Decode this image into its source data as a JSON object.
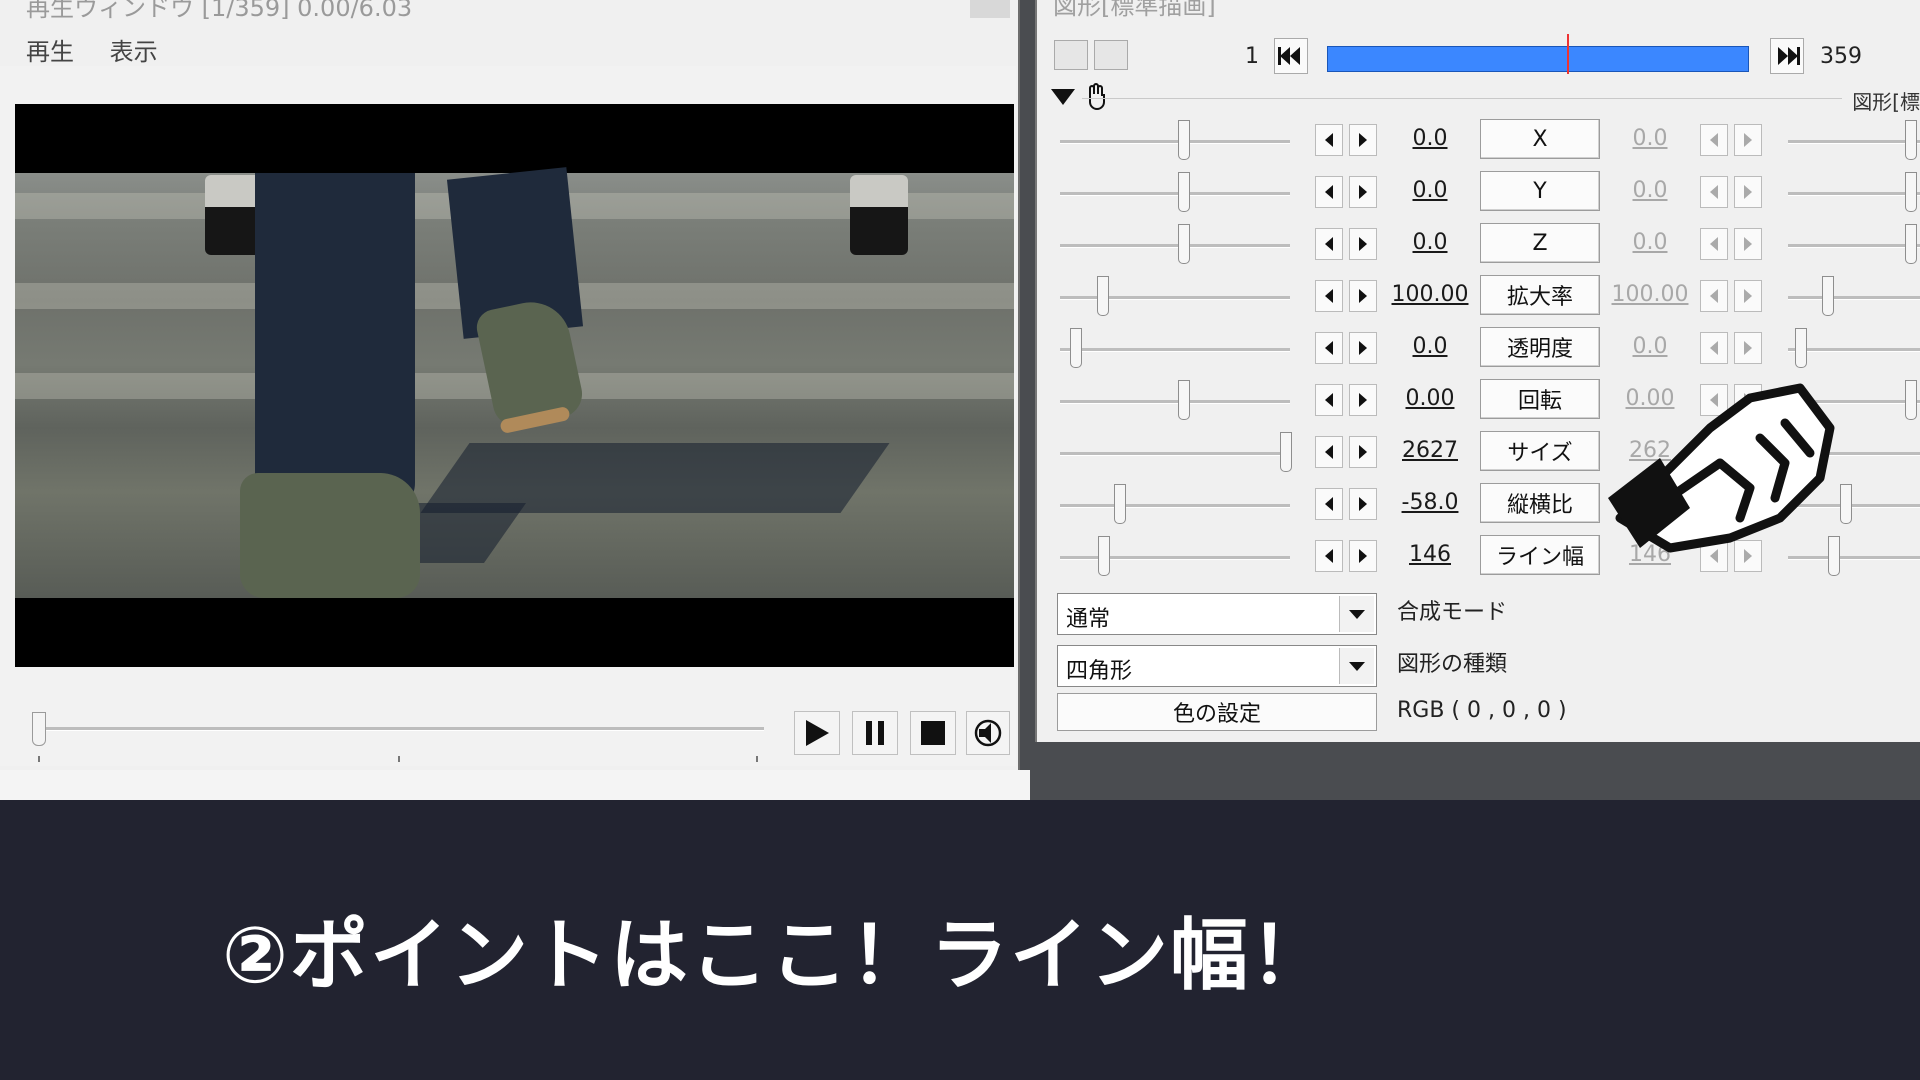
{
  "playback_window": {
    "title": "再生ウィンドウ [1/359]  0.00/6.03",
    "menu": [
      "再生",
      "表示"
    ],
    "controls": {
      "play": "play",
      "pause": "pause",
      "stop": "stop",
      "audio": "speaker"
    }
  },
  "settings_panel": {
    "title": "図形[標準描画]",
    "frame_start": "1",
    "frame_end": "359",
    "object_label": "図形[標",
    "params": [
      {
        "label": "X",
        "start": "0.0",
        "end": "0.0"
      },
      {
        "label": "Y",
        "start": "0.0",
        "end": "0.0"
      },
      {
        "label": "Z",
        "start": "0.0",
        "end": "0.0"
      },
      {
        "label": "拡大率",
        "start": "100.00",
        "end": "100.00"
      },
      {
        "label": "透明度",
        "start": "0.0",
        "end": "0.0"
      },
      {
        "label": "回転",
        "start": "0.00",
        "end": "0.00"
      },
      {
        "label": "サイズ",
        "start": "2627",
        "end": "262"
      },
      {
        "label": "縦横比",
        "start": "-58.0",
        "end": ""
      },
      {
        "label": "ライン幅",
        "start": "146",
        "end": "146"
      }
    ],
    "blend_mode": {
      "value": "通常",
      "label": "合成モード"
    },
    "shape_type": {
      "value": "四角形",
      "label": "図形の種類"
    },
    "color": {
      "button": "色の設定",
      "value": "RGB ( 0 , 0 , 0 )"
    }
  },
  "caption": "②ポイントはここ！ライン幅！",
  "colors": {
    "timeline": "#3b87ff",
    "caption_bg": "#222330"
  }
}
